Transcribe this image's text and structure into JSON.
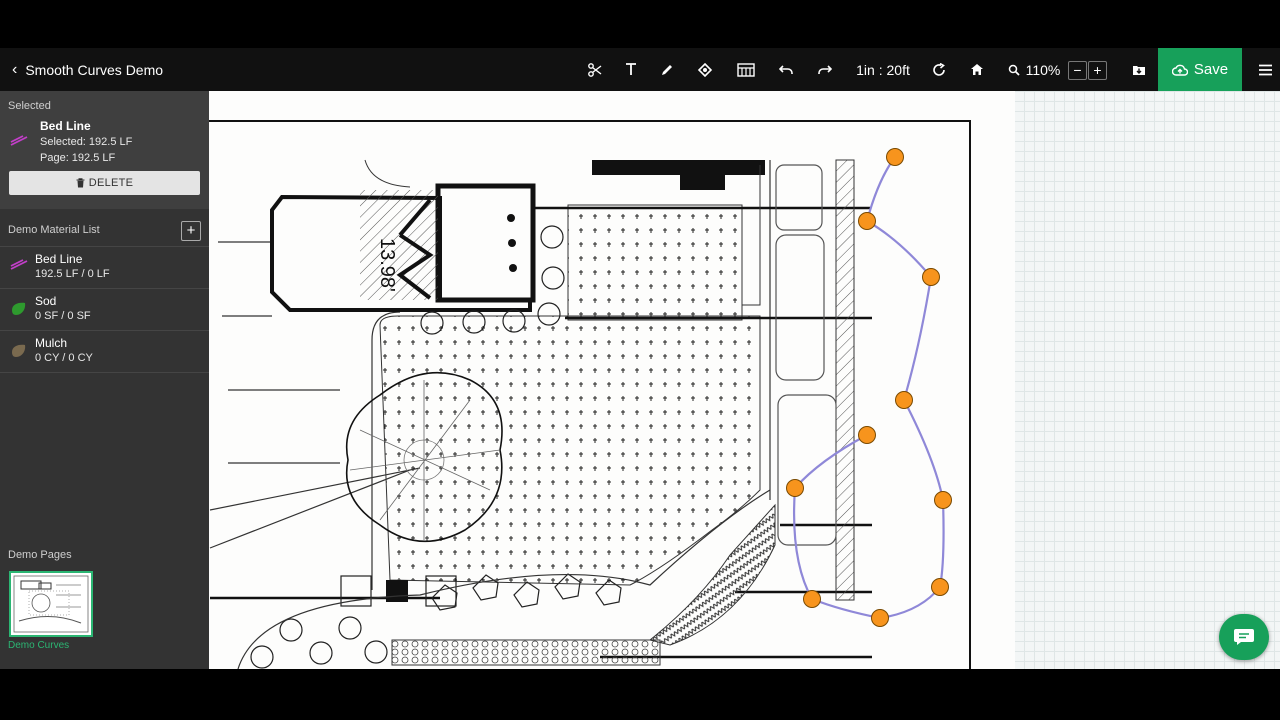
{
  "header": {
    "back_label": "Smooth Curves Demo",
    "scale_label": "1in : 20ft",
    "zoom_label": "110%",
    "zoom_minus": "−",
    "zoom_plus": "+",
    "save_label": "Save",
    "tools": [
      "scissors-icon",
      "text-icon",
      "pencil-icon",
      "color-picker-icon",
      "layers-icon",
      "undo-icon",
      "redo-icon",
      "refresh-icon",
      "home-icon",
      "zoom-icon",
      "download-icon",
      "menu-icon"
    ]
  },
  "sidebar": {
    "selected": {
      "section_title": "Selected",
      "name": "Bed Line",
      "selected_value": "Selected: 192.5 LF",
      "page_value": "Page: 192.5 LF",
      "delete_label": "DELETE"
    },
    "material_list": {
      "title": "Demo Material List",
      "add_label": "+",
      "items": [
        {
          "name": "Bed Line",
          "value": "192.5 LF / 0 LF",
          "icon": "bed-line-icon",
          "color": "#c23fc9"
        },
        {
          "name": "Sod",
          "value": "0 SF / 0 SF",
          "icon": "sod-icon",
          "color": "#2e9a2e"
        },
        {
          "name": "Mulch",
          "value": "0 CY / 0 CY",
          "icon": "mulch-icon",
          "color": "#7a6a4f"
        }
      ]
    },
    "pages": {
      "title": "Demo Pages",
      "items": [
        {
          "label": "Demo Curves"
        }
      ]
    }
  },
  "canvas": {
    "dimension_label": "13.98'",
    "curve_color": "#8f88d8",
    "point_color": "#f7941d"
  },
  "colors": {
    "accent": "#17a05a",
    "topbar": "#111111",
    "sidebar": "#333333"
  }
}
